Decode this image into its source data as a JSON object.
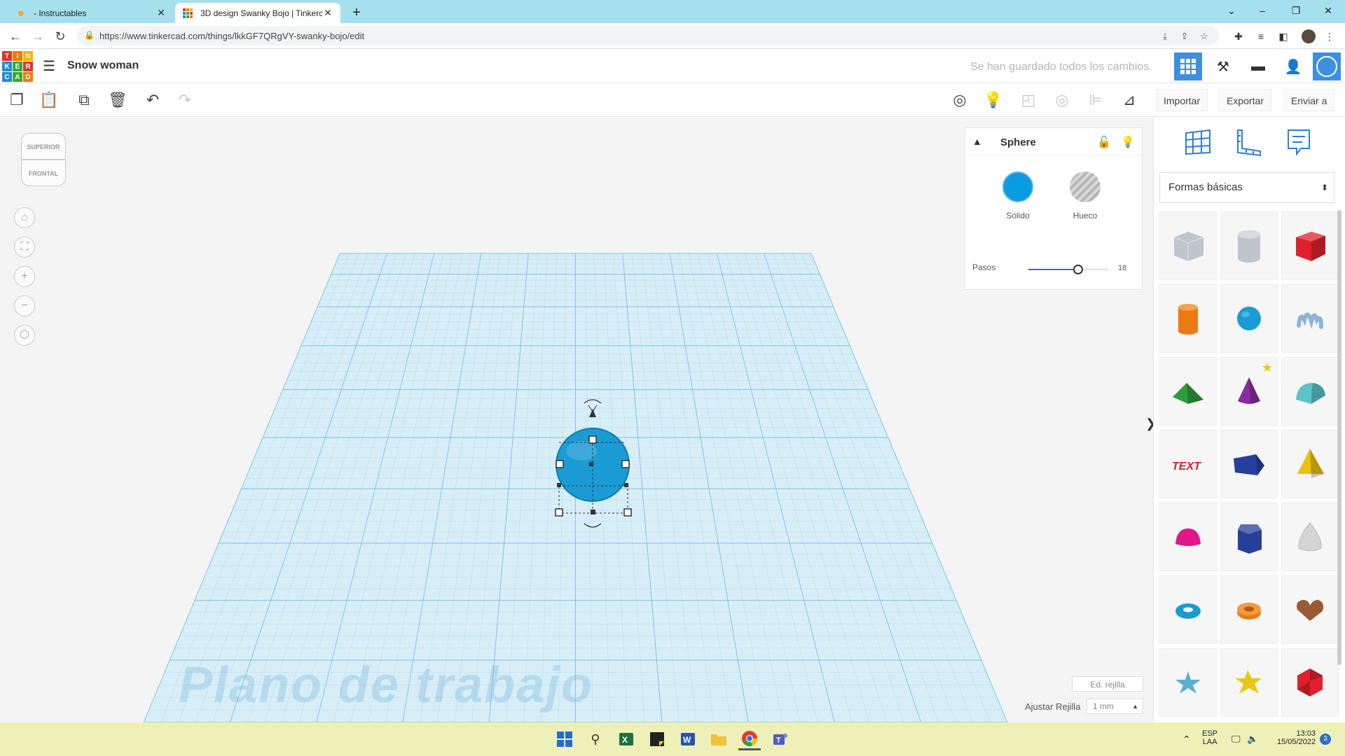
{
  "browser": {
    "tabs": [
      {
        "title": " - Instructables",
        "favicon": "instructables-robot-icon"
      },
      {
        "title": "3D design Swanky Bojo | Tinkerc",
        "favicon": "tinkercad-grid-icon"
      }
    ],
    "url": "https://www.tinkercad.com/things/lkkGF7QRgVY-swanky-bojo/edit"
  },
  "app": {
    "logo_letters": [
      "T",
      "I",
      "N",
      "K",
      "E",
      "R",
      "C",
      "A",
      "D"
    ],
    "logo_colors": [
      "#e2342a",
      "#ef7d00",
      "#f8b400",
      "#1f8fd1",
      "#3aa935",
      "#e2342a",
      "#1f8fd1",
      "#3aa935",
      "#ef7d00"
    ],
    "design_name": "Snow woman",
    "save_status": "Se han guardado todos los cambios.",
    "accent": "#3e8fe0"
  },
  "toolbar": {
    "import_label": "Importar",
    "export_label": "Exportar",
    "send_label": "Enviar a"
  },
  "viewcube": {
    "top": "SUPERIOR",
    "front": "FRONTAL"
  },
  "workplane": {
    "label": "Plano de trabajo",
    "color": "#b5e2f2"
  },
  "selected_shape": {
    "color": "#1a9bd4"
  },
  "inspector": {
    "shape_name": "Sphere",
    "solid_label": "Sólido",
    "hole_label": "Hueco",
    "steps_label": "Pasos",
    "steps_value": "18",
    "steps_fraction": 0.62,
    "solid_color": "#0a9ce0"
  },
  "grid": {
    "edit_label": "Ed. rejilla",
    "snap_label": "Ajustar Rejilla",
    "snap_value": "1 mm"
  },
  "shapes_panel": {
    "category": "Formas básicas",
    "shapes": [
      {
        "name": "box-hole",
        "color": "#c0c4cc"
      },
      {
        "name": "cylinder-hole",
        "color": "#c0c4cc"
      },
      {
        "name": "box",
        "color": "#e0202c"
      },
      {
        "name": "cylinder",
        "color": "#ec7a12"
      },
      {
        "name": "sphere",
        "color": "#1a9bd4"
      },
      {
        "name": "scribble",
        "color": "#8cb4d8"
      },
      {
        "name": "roof",
        "color": "#2e9b3c"
      },
      {
        "name": "cone",
        "color": "#8a2d9e"
      },
      {
        "name": "round-roof",
        "color": "#5cc3c8"
      },
      {
        "name": "text",
        "color": "#d42030"
      },
      {
        "name": "wedge",
        "color": "#24409a"
      },
      {
        "name": "pyramid",
        "color": "#eac20e"
      },
      {
        "name": "half-sphere",
        "color": "#e0168a"
      },
      {
        "name": "polygon",
        "color": "#24409a"
      },
      {
        "name": "paraboloid",
        "color": "#d4d4d4"
      },
      {
        "name": "torus",
        "color": "#1a9bd4"
      },
      {
        "name": "tube",
        "color": "#ec7a12"
      },
      {
        "name": "heart",
        "color": "#9a5a34"
      },
      {
        "name": "star",
        "color": "#58b0d4"
      },
      {
        "name": "star-yellow",
        "color": "#e8c816"
      },
      {
        "name": "icosahedron",
        "color": "#e0202c"
      }
    ]
  },
  "taskbar": {
    "lang": "ESP",
    "layout": "LAA",
    "time": "13:03",
    "date": "15/05/2022",
    "notifications": "3"
  }
}
